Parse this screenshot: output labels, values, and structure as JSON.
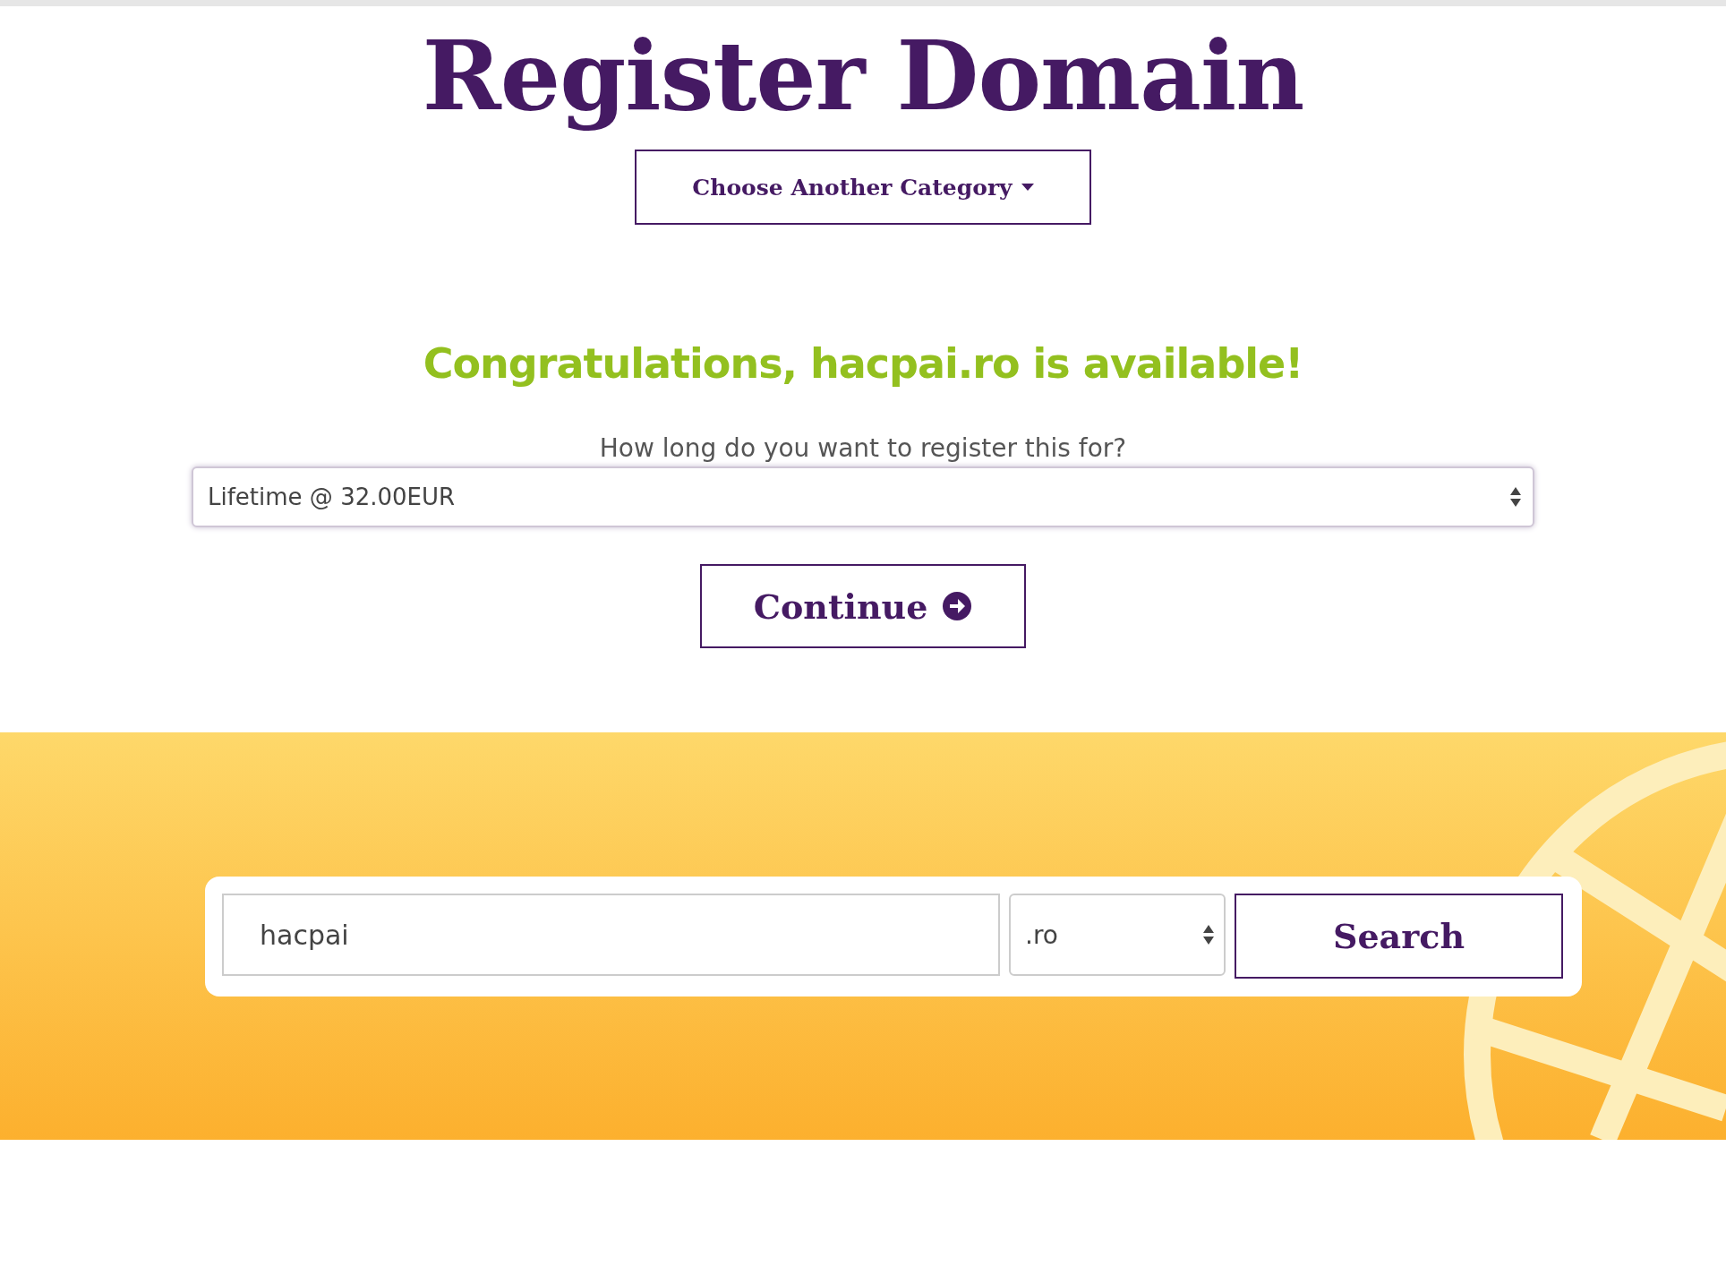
{
  "title": "Register Domain",
  "category_button": {
    "label": "Choose Another Category"
  },
  "message": "Congratulations, hacpai.ro is available!",
  "period": {
    "question": "How long do you want to register this for?",
    "value": "Lifetime @ 32.00EUR"
  },
  "continue_button": {
    "label": "Continue"
  },
  "search": {
    "domain": "hacpai",
    "extension": ".ro",
    "button": "Search"
  }
}
